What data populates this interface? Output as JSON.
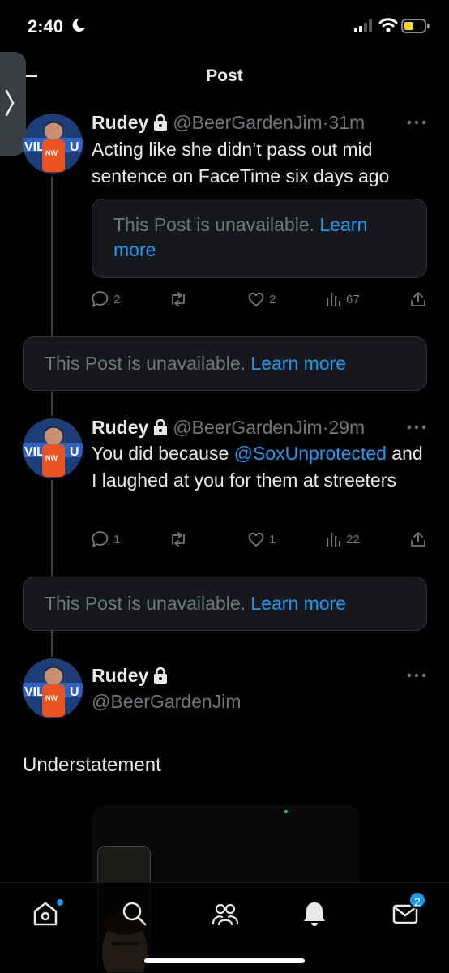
{
  "status_bar": {
    "time": "2:40"
  },
  "header": {
    "title": "Post"
  },
  "tweets": [
    {
      "name": "Rudey",
      "handle": "@BeerGardenJim",
      "time": "31m",
      "text": "Acting like she didn’t pass out mid sentence on FaceTime six days ago",
      "quote": {
        "text": "This Post is unavailable.",
        "link": "Learn more"
      },
      "replies": "2",
      "likes": "2",
      "views": "67"
    },
    {
      "name": "Rudey",
      "handle": "@BeerGardenJim",
      "time": "29m",
      "text_before": "You did because ",
      "mention": "@SoxUnprotected",
      "text_after": " and I laughed at you for them at streeters",
      "replies": "1",
      "likes": "1",
      "views": "22"
    }
  ],
  "unavailable": [
    {
      "text": "This Post is unavailable.",
      "link": "Learn more"
    },
    {
      "text": "This Post is unavailable.",
      "link": "Learn more"
    }
  ],
  "main_tweet": {
    "name": "Rudey",
    "handle": "@BeerGardenJim",
    "text": "Understatement"
  },
  "tab_bar": {
    "items": [
      "home-icon",
      "search-icon",
      "communities-icon",
      "notifications-icon",
      "messages-icon"
    ],
    "messages_badge": "2"
  },
  "colors": {
    "accent": "#1d9bf0",
    "background": "#000000",
    "card": "#16181c",
    "muted": "#71767b"
  }
}
